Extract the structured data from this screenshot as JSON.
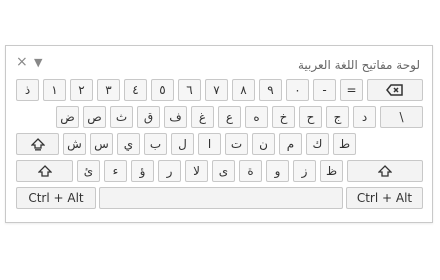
{
  "keyboard": {
    "title": "لوحة مفاتيح اللغة العربية",
    "close_icon": "×",
    "menu_icon": "▼"
  },
  "row1": [
    "ذ",
    "١",
    "٢",
    "٣",
    "٤",
    "٥",
    "٦",
    "٧",
    "٨",
    "٩",
    "٠",
    "-",
    "="
  ],
  "row2": [
    "ض",
    "ص",
    "ث",
    "ق",
    "ف",
    "غ",
    "ع",
    "ه",
    "خ",
    "ح",
    "ج",
    "د",
    "\\"
  ],
  "row3": [
    "ش",
    "س",
    "ي",
    "ب",
    "ل",
    "ا",
    "ت",
    "ن",
    "م",
    "ك",
    "ط"
  ],
  "row4": [
    "ئ",
    "ء",
    "ؤ",
    "ر",
    "لا",
    "ى",
    "ة",
    "و",
    "ز",
    "ظ"
  ],
  "bottom": {
    "left": "Ctrl + Alt",
    "right": "Ctrl + Alt"
  },
  "icons": {
    "backspace": "backspace-icon",
    "caps": "caps-lock-icon",
    "shift": "shift-icon"
  }
}
